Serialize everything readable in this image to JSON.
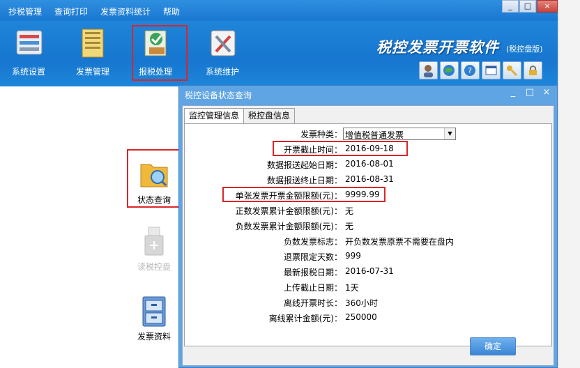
{
  "menubar": {
    "items": [
      "抄税管理",
      "查询打印",
      "发票资料统计",
      "帮助"
    ]
  },
  "window_controls": [
    "_",
    "□",
    "×"
  ],
  "toolbar": {
    "items": [
      {
        "label": "系统设置",
        "icon": "settings-panel-icon"
      },
      {
        "label": "发票管理",
        "icon": "invoice-folder-icon"
      },
      {
        "label": "报税处理",
        "icon": "tax-report-icon"
      },
      {
        "label": "系统维护",
        "icon": "maintenance-tools-icon"
      }
    ],
    "brand_title": "税控发票开票软件",
    "brand_sub": "(税控盘版)",
    "quick_icons": [
      "user-icon",
      "globe-icon",
      "help-icon",
      "window-icon",
      "key-icon",
      "lock-icon"
    ]
  },
  "leftpanel": {
    "items": [
      {
        "label": "状态查询",
        "icon": "folder-search-icon"
      },
      {
        "label": "读税控盘",
        "icon": "usb-icon"
      },
      {
        "label": "发票资料",
        "icon": "cabinet-icon"
      }
    ]
  },
  "dialog": {
    "title": "税控设备状态查询",
    "controls": [
      "_",
      "□",
      "×"
    ],
    "tabs": [
      "监控管理信息",
      "税控盘信息"
    ],
    "invoice_type_label": "发票种类：",
    "invoice_type_value": "增值税普通发票",
    "fields": [
      {
        "label": "开票截止时间：",
        "value": "2016-09-18"
      },
      {
        "label": "数据报送起始日期：",
        "value": "2016-08-01"
      },
      {
        "label": "数据报送终止日期：",
        "value": "2016-08-31"
      },
      {
        "label": "单张发票开票金额限额(元)：",
        "value": "9999.99"
      },
      {
        "label": "正数发票累计金额限额(元)：",
        "value": "无"
      },
      {
        "label": "负数发票累计金额限额(元)：",
        "value": "无"
      },
      {
        "label": "负数发票标志：",
        "value": "开负数发票原票不需要在盘内"
      },
      {
        "label": "退票限定天数：",
        "value": "999"
      },
      {
        "label": "最新报税日期：",
        "value": "2016-07-31"
      },
      {
        "label": "上传截止日期：",
        "value": "1天"
      },
      {
        "label": "离线开票时长：",
        "value": "360小时"
      },
      {
        "label": "离线累计金额(元)：",
        "value": "250000"
      }
    ],
    "ok_label": "确定"
  },
  "colors": {
    "accent_blue": "#1977d1",
    "highlight_red": "#d8262a",
    "dialog_blue": "#5fa4e3"
  }
}
